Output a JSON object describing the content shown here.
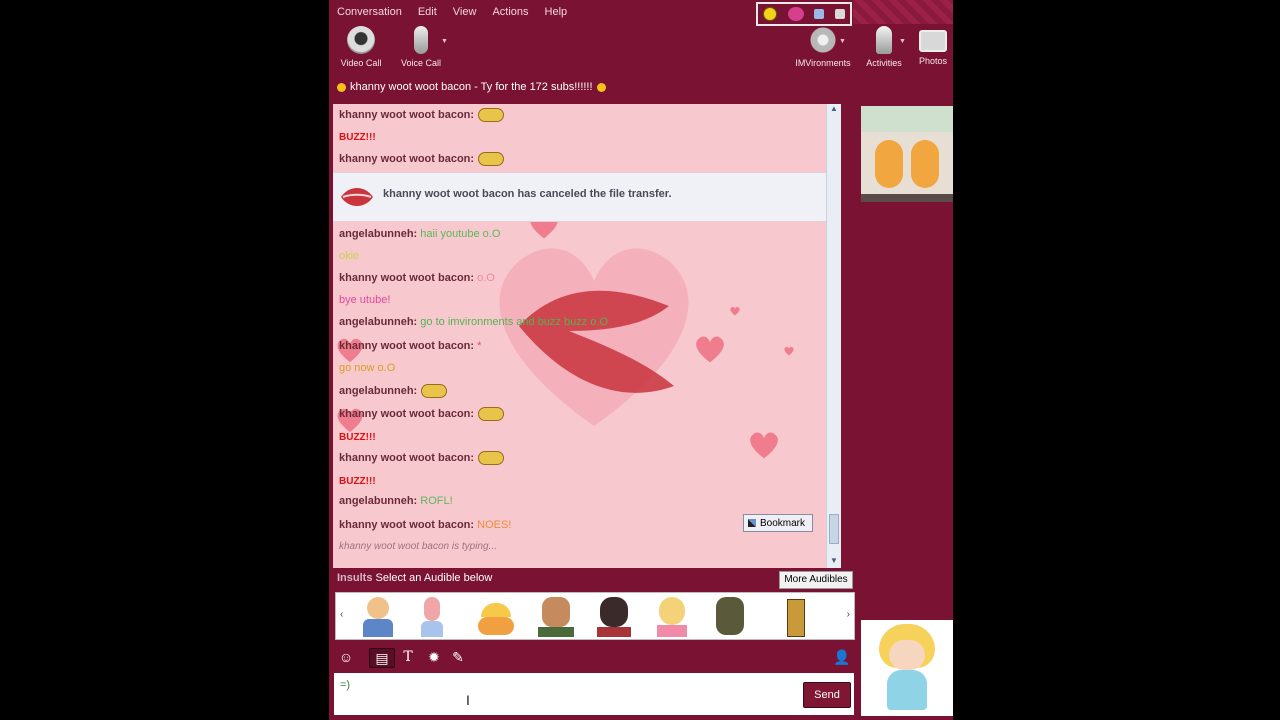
{
  "menu": [
    "Conversation",
    "Edit",
    "View",
    "Actions",
    "Help"
  ],
  "toolbar": {
    "video_call": "Video Call",
    "voice_call": "Voice Call",
    "imvironments": "IMVironments",
    "activities": "Activities",
    "photos": "Photos"
  },
  "status_message": "khanny woot woot bacon - Ty for the 172 subs!!!!!!",
  "chat": {
    "lines": [
      {
        "name": "khanny woot woot bacon:",
        "text": ""
      },
      {
        "name": "",
        "text": "BUZZ!!!"
      },
      {
        "name": "khanny woot woot bacon:",
        "text": ""
      },
      {
        "name": "angelabunneh:",
        "text": "haii youtube o.O"
      },
      {
        "name": "",
        "text": "okie"
      },
      {
        "name": "khanny woot woot bacon:",
        "text": "o.O"
      },
      {
        "name": "",
        "text": "bye utube!"
      },
      {
        "name": "angelabunneh:",
        "text": "go to imvironments and buzz buzz o.O"
      },
      {
        "name": "khanny woot woot bacon:",
        "text": "*"
      },
      {
        "name": "",
        "text": "go now o.O"
      },
      {
        "name": "angelabunneh:",
        "text": ""
      },
      {
        "name": "khanny woot woot bacon:",
        "text": ""
      },
      {
        "name": "",
        "text": "BUZZ!!!"
      },
      {
        "name": "khanny woot woot bacon:",
        "text": ""
      },
      {
        "name": "",
        "text": "BUZZ!!!"
      },
      {
        "name": "angelabunneh:",
        "text": "ROFL!"
      },
      {
        "name": "khanny woot woot bacon:",
        "text": "NOES!"
      }
    ],
    "file_transfer": "khanny woot woot bacon has canceled the file transfer.",
    "typing": "khanny woot woot bacon is typing...",
    "bookmark": "Bookmark"
  },
  "audibles": {
    "category": "Insults",
    "prompt": "Select an Audible below",
    "more": "More Audibles"
  },
  "input": {
    "value": "=)",
    "send": "Send"
  },
  "colors": {
    "window": "#7a1233",
    "chat_bg": "#f7c9cf",
    "heart": "#e8707e"
  }
}
